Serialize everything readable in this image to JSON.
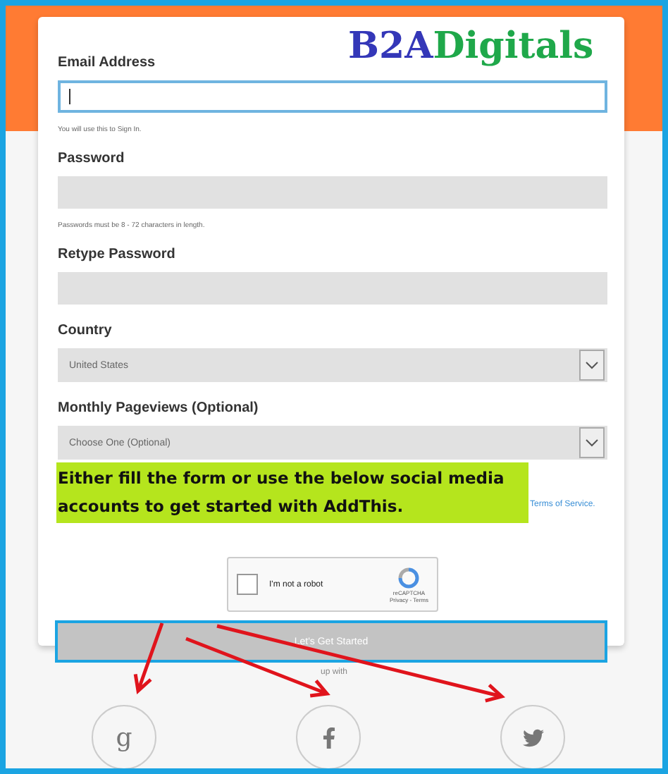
{
  "logo": {
    "part_1": "B2A",
    "part_2": "Digitals"
  },
  "fields": [
    {
      "kind": "input",
      "label": "Email Address",
      "focused": true,
      "hint": "You will use this to Sign In."
    },
    {
      "kind": "input",
      "label": "Password",
      "focused": false,
      "hint": "Passwords must be 8 - 72 characters in length."
    },
    {
      "kind": "input",
      "label": "Retype Password",
      "focused": false
    },
    {
      "kind": "select",
      "label": "Country",
      "value": "United States"
    },
    {
      "kind": "select",
      "label": "Monthly Pageviews (Optional)",
      "value": "Choose One (Optional)"
    }
  ],
  "annotation": "Either fill the form or use the below social media accounts to get started with AddThis.",
  "terms_link": "Terms of Service.",
  "captcha": {
    "label": "I'm not a robot",
    "checked": false,
    "brand": "reCAPTCHA",
    "links": "Privacy - Terms"
  },
  "submit_button": "Let's Get Started",
  "social": {
    "heading": "up with",
    "buttons": [
      {
        "kind": "google",
        "glyph": "g"
      },
      {
        "kind": "facebook"
      },
      {
        "kind": "twitter"
      }
    ]
  }
}
